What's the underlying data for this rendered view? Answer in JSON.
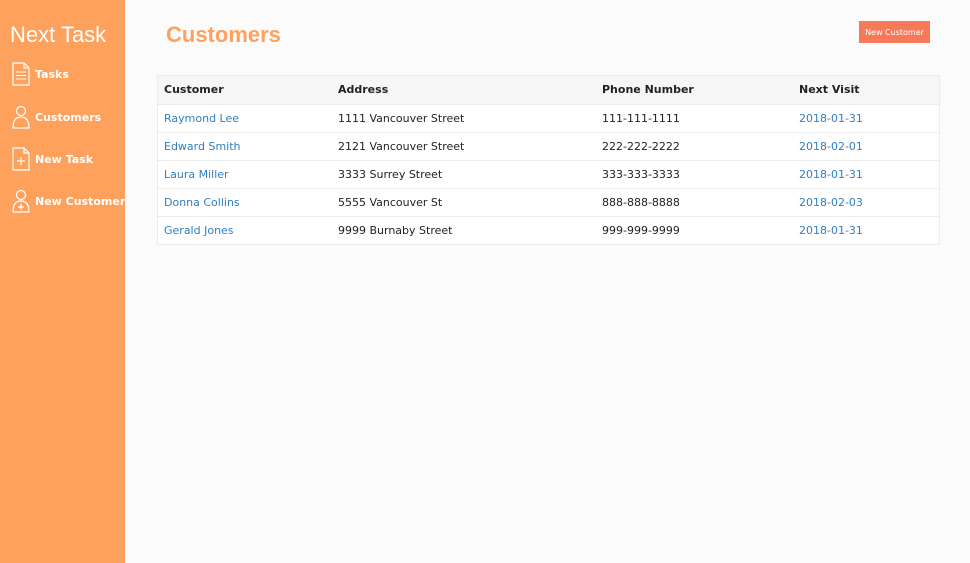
{
  "sidebar": {
    "brand": "Next Task",
    "items": [
      {
        "label": "Tasks",
        "icon": "document-icon"
      },
      {
        "label": "Customers",
        "icon": "person-icon"
      },
      {
        "label": "New Task",
        "icon": "add-document-icon"
      },
      {
        "label": "New Customer",
        "icon": "add-person-icon"
      }
    ]
  },
  "main": {
    "title": "Customers",
    "new_button_label": "New Customer",
    "table": {
      "headers": [
        "Customer",
        "Address",
        "Phone Number",
        "Next Visit"
      ],
      "rows": [
        {
          "name": "Raymond Lee",
          "address": "1111 Vancouver Street",
          "phone": "111-111-1111",
          "next_visit": "2018-01-31"
        },
        {
          "name": "Edward Smith",
          "address": "2121 Vancouver Street",
          "phone": "222-222-2222",
          "next_visit": "2018-02-01"
        },
        {
          "name": "Laura Miller",
          "address": "3333 Surrey Street",
          "phone": "333-333-3333",
          "next_visit": "2018-01-31"
        },
        {
          "name": "Donna Collins",
          "address": "5555 Vancouver St",
          "phone": "888-888-8888",
          "next_visit": "2018-02-03"
        },
        {
          "name": "Gerald Jones",
          "address": "9999 Burnaby Street",
          "phone": "999-999-9999",
          "next_visit": "2018-01-31"
        }
      ]
    }
  },
  "colors": {
    "sidebar_bg": "#fea15d",
    "accent": "#fea15d",
    "button_bg": "#f67a5a",
    "link": "#2f7fc1",
    "page_bg": "#fbfbfb"
  }
}
